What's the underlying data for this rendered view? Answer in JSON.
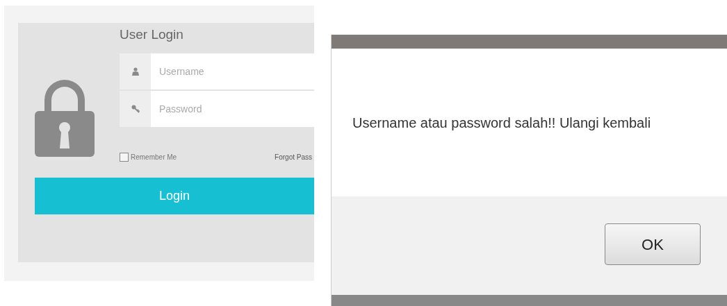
{
  "login_panel": {
    "title": "User Login",
    "fields": [
      {
        "kind": "user",
        "placeholder": "Username"
      },
      {
        "kind": "key",
        "placeholder": "Password"
      }
    ],
    "remember_me": {
      "label": "Remember Me",
      "checked": false
    },
    "forgot_link": "Forgot Pass",
    "login_button": "Login"
  },
  "alert_dialog": {
    "message": "Username atau password salah!! Ulangi kembali",
    "buttons": [
      "OK"
    ]
  }
}
